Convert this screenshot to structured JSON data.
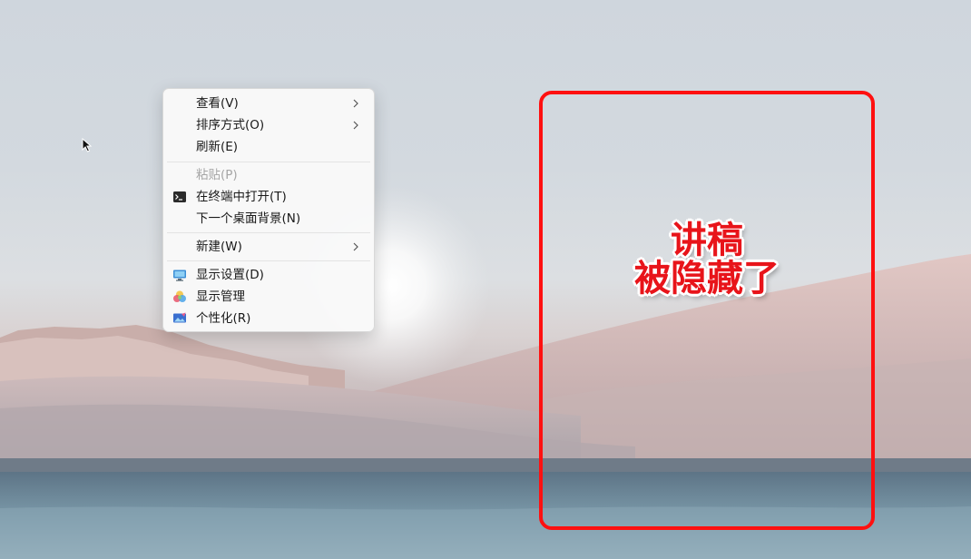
{
  "context_menu": {
    "items": [
      {
        "label": "查看(V)",
        "has_submenu": true,
        "enabled": true,
        "icon": null
      },
      {
        "label": "排序方式(O)",
        "has_submenu": true,
        "enabled": true,
        "icon": null
      },
      {
        "label": "刷新(E)",
        "has_submenu": false,
        "enabled": true,
        "icon": null
      },
      {
        "label": "粘贴(P)",
        "has_submenu": false,
        "enabled": false,
        "icon": null
      },
      {
        "label": "在终端中打开(T)",
        "has_submenu": false,
        "enabled": true,
        "icon": "terminal-icon"
      },
      {
        "label": "下一个桌面背景(N)",
        "has_submenu": false,
        "enabled": true,
        "icon": null
      },
      {
        "label": "新建(W)",
        "has_submenu": true,
        "enabled": true,
        "icon": null
      },
      {
        "label": "显示设置(D)",
        "has_submenu": false,
        "enabled": true,
        "icon": "display-settings-icon"
      },
      {
        "label": "显示管理",
        "has_submenu": false,
        "enabled": true,
        "icon": "display-manager-icon"
      },
      {
        "label": "个性化(R)",
        "has_submenu": false,
        "enabled": true,
        "icon": "personalize-icon"
      }
    ]
  },
  "annotation": {
    "line1": "讲稿",
    "line2": "被隐藏了",
    "color": "#ff1010"
  },
  "icons": {
    "cursor": "arrow-cursor-icon",
    "submenu": "chevron-right-icon"
  }
}
